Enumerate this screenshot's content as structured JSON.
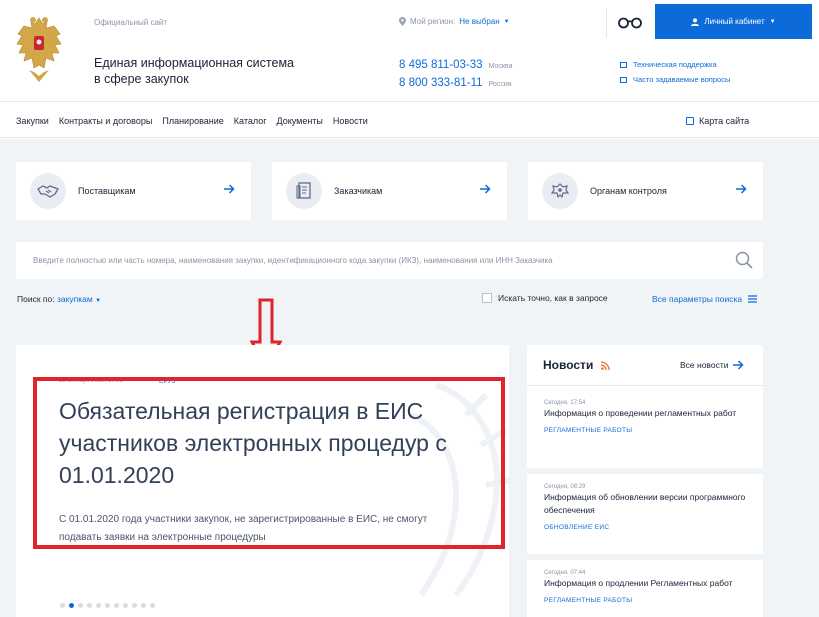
{
  "header": {
    "official_site": "Официальный сайт",
    "title_line1": "Единая информационная система",
    "title_line2": "в сфере закупок",
    "region_label": "Мой регион:",
    "region_value": "Не выбран",
    "phones": [
      {
        "number": "8 495 811-03-33",
        "city": "Москва"
      },
      {
        "number": "8 800 333-81-11",
        "city": "Россия"
      }
    ],
    "cabinet_label": "Личный кабинет",
    "support_links": [
      "Техническая поддержка",
      "Часто задаваемые вопросы"
    ]
  },
  "nav": {
    "items": [
      "Закупки",
      "Контракты и договоры",
      "Планирование",
      "Каталог",
      "Документы",
      "Новости"
    ],
    "sitemap": "Карта сайта"
  },
  "cards": [
    {
      "label": "Поставщикам",
      "icon": "handshake-icon"
    },
    {
      "label": "Заказчикам",
      "icon": "document-icon"
    },
    {
      "label": "Органам контроля",
      "icon": "emblem-icon"
    }
  ],
  "search": {
    "placeholder": "Введите полностью или часть номера, наименования закупки, идентификационного кода закупки (ИКЗ), наименования или ИНН Заказчика",
    "search_by_label": "Поиск по:",
    "search_by_value": "закупкам",
    "exact_label": "Искать точно, как в запросе",
    "all_params": "Все параметры поиска"
  },
  "slide": {
    "date": "28 октября 2019, 17:03",
    "tag": "ЕРУЗ",
    "title": "Обязательная регистрация в ЕИС участников электронных процедур с 01.01.2020",
    "text": "С 01.01.2020 года участники закупок, не зарегистрированные в ЕИС, не смогут подавать заявки на электронные процедуры",
    "dots_total": 11,
    "dots_active": 1
  },
  "news": {
    "title": "Новости",
    "all_news": "Все новости",
    "items": [
      {
        "time": "Сегодня, 17:54",
        "headline": "Информация о проведении регламентных работ",
        "category": "РЕГЛАМЕНТНЫЕ РАБОТЫ"
      },
      {
        "time": "Сегодня, 08:29",
        "headline": "Информация об обновлении версии программного обеспечения",
        "category": "ОБНОВЛЕНИЕ ЕИС"
      },
      {
        "time": "Сегодня, 07:44",
        "headline": "Информация о продлении Регламентных работ",
        "category": "РЕГЛАМЕНТНЫЕ РАБОТЫ"
      }
    ]
  },
  "colors": {
    "accent": "#0d6bd9",
    "highlight": "#e0242c",
    "background": "#f1f4f7"
  }
}
